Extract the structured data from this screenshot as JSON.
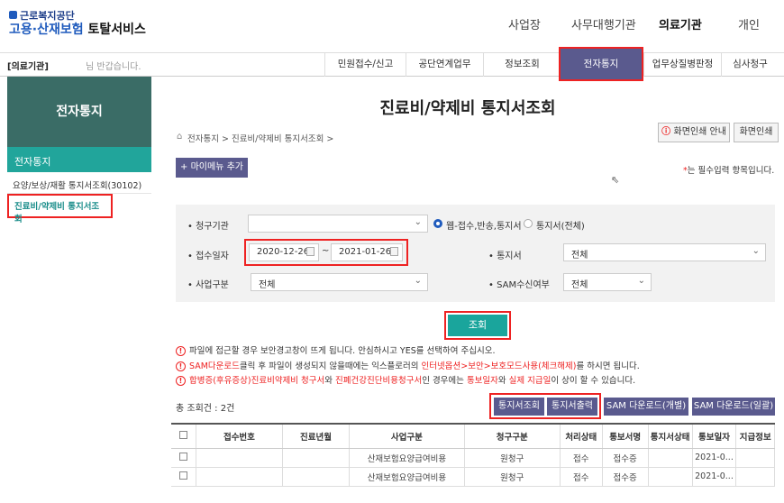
{
  "header": {
    "logo_small": "근로복지공단",
    "logo_part1": "고용·산재보험",
    "logo_part2": " 토탈서비스",
    "nav": [
      "사업장",
      "사무대행기관",
      "의료기관",
      "개인"
    ]
  },
  "subbar": {
    "role": "[의료기관]",
    "greeting": "님 반갑습니다.",
    "menu": [
      "민원접수/신고",
      "공단연계업무",
      "정보조회",
      "전자통지",
      "업무상질병판정",
      "심사청구"
    ]
  },
  "sidebar": {
    "header": "전자통지",
    "category": "전자통지",
    "items": [
      "요양/보상/재활 통지서조회(30102)",
      "진료비/약제비 통지서조회"
    ]
  },
  "main": {
    "title": "진료비/약제비 통지서조회",
    "breadcrumb": "전자통지 > 진료비/약제비 통지서조회 >",
    "print_guide": "화면인쇄 안내",
    "print": "화면인쇄",
    "my_menu": "+ 마이메뉴 추가",
    "required_star": "*",
    "required_note": "는 필수입력 항목입니다."
  },
  "form": {
    "claim_org_label": "청구기관",
    "claim_org_value": "",
    "radio1": "웹-접수,반송,통지서",
    "radio2": "통지서(전체)",
    "date_label": "접수일자",
    "date_from": "2020-12-26",
    "date_tilde": "~",
    "date_to": "2021-01-26",
    "notice_label": "통지서",
    "notice_value": "전체",
    "biz_label": "사업구분",
    "biz_value": "전체",
    "sam_label": "SAM수신여부",
    "sam_value": "전체",
    "search": "조회"
  },
  "notices": [
    {
      "parts": [
        {
          "t": "파일에 접근할 경우 보안경고창이 뜨게 됩니다. 안심하시고 YES를 선택하여 주십시오.",
          "red": false
        }
      ]
    },
    {
      "parts": [
        {
          "t": "SAM다운로드",
          "red": true
        },
        {
          "t": "클릭 후 파일이 생성되지 않을때에는 익스플로러의 ",
          "red": false
        },
        {
          "t": "인터넷옵션>보안>보호모드사용(체크해제)",
          "red": true
        },
        {
          "t": "를 하시면 됩니다.",
          "red": false
        }
      ]
    },
    {
      "parts": [
        {
          "t": "합병증(후유증상)진료비약제비 청구서",
          "red": true
        },
        {
          "t": "와 ",
          "red": false
        },
        {
          "t": "진폐건강진단비용청구서",
          "red": true
        },
        {
          "t": "인 경우에는 ",
          "red": false
        },
        {
          "t": "통보일자",
          "red": true
        },
        {
          "t": "와 ",
          "red": false
        },
        {
          "t": "실제 지급일",
          "red": true
        },
        {
          "t": "이 상이 할 수 있습니다.",
          "red": false
        }
      ]
    }
  ],
  "results": {
    "total": "총 조회건 : 2건",
    "buttons": [
      "통지서조회",
      "통지서출력",
      "SAM 다운로드(개별)",
      "SAM 다운로드(일괄)"
    ],
    "columns": [
      "",
      "접수번호",
      "진료년월",
      "사업구분",
      "청구구분",
      "처리상태",
      "통보서명",
      "통지서상태",
      "통보일자",
      "지급정보"
    ],
    "rows": [
      [
        "",
        "",
        "",
        "산재보험요양급여비용",
        "원청구",
        "접수",
        "접수증",
        "",
        "2021-0...",
        ""
      ],
      [
        "",
        "",
        "",
        "산재보험요양급여비용",
        "원청구",
        "접수",
        "접수증",
        "",
        "2021-0...",
        ""
      ]
    ]
  },
  "colors": {
    "teal": "#21a59b",
    "purple": "#5a5a8e",
    "red_highlight": "#e22222"
  }
}
